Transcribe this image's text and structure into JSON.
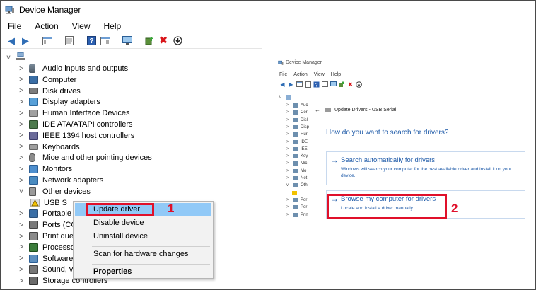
{
  "left": {
    "window": {
      "title": "Device Manager"
    },
    "menu": [
      "File",
      "Action",
      "View",
      "Help"
    ],
    "tree": {
      "root_chevron": "v",
      "items": [
        {
          "label": "Audio inputs and outputs",
          "icon": "speaker-icon"
        },
        {
          "label": "Computer",
          "icon": "computer-icon"
        },
        {
          "label": "Disk drives",
          "icon": "disk-drive-icon"
        },
        {
          "label": "Display adapters",
          "icon": "display-adapter-icon"
        },
        {
          "label": "Human Interface Devices",
          "icon": "hid-icon"
        },
        {
          "label": "IDE ATA/ATAPI controllers",
          "icon": "ide-controller-icon"
        },
        {
          "label": "IEEE 1394 host controllers",
          "icon": "ieee1394-icon"
        },
        {
          "label": "Keyboards",
          "icon": "keyboard-icon"
        },
        {
          "label": "Mice and other pointing devices",
          "icon": "mouse-icon"
        },
        {
          "label": "Monitors",
          "icon": "monitor-icon"
        },
        {
          "label": "Network adapters",
          "icon": "network-adapter-icon"
        },
        {
          "label": "Other devices",
          "icon": "other-devices-icon"
        },
        {
          "label": "USB S",
          "icon": "warning-device-icon"
        },
        {
          "label": "Portable",
          "icon": "portable-device-icon"
        },
        {
          "label": "Ports (CO",
          "icon": "port-icon"
        },
        {
          "label": "Print que",
          "icon": "printer-icon"
        },
        {
          "label": "Processo",
          "icon": "processor-icon"
        },
        {
          "label": "Software",
          "icon": "software-icon"
        },
        {
          "label": "Sound, v",
          "icon": "sound-icon"
        },
        {
          "label": "Storage controllers",
          "icon": "storage-controller-icon"
        }
      ]
    },
    "context_menu": {
      "update": "Update driver",
      "disable": "Disable device",
      "uninstall": "Uninstall device",
      "scan": "Scan for hardware changes",
      "properties": "Properties"
    },
    "step_label": "1",
    "highlight_color": "#e0102a"
  },
  "right": {
    "window": {
      "title": "Device Manager"
    },
    "menu": [
      "File",
      "Action",
      "View",
      "Help"
    ],
    "tree_labels": [
      "Auc",
      "Cor",
      "Disl",
      "Disp",
      "Hur",
      "IDE",
      "IEEI",
      "Key",
      "Mic",
      "Mo",
      "Net",
      "Oth",
      "",
      "Por",
      "Por",
      "Prin"
    ],
    "dialog": {
      "header": "Update Drivers - USB Serial",
      "question": "How do you want to search for drivers?",
      "option_auto": {
        "title": "Search automatically for drivers",
        "description": "Windows will search your computer for the best available driver and install it on your device."
      },
      "option_browse": {
        "title": "Browse my computer for drivers",
        "description": "Locate and install a driver manually."
      }
    },
    "step_label": "2"
  }
}
